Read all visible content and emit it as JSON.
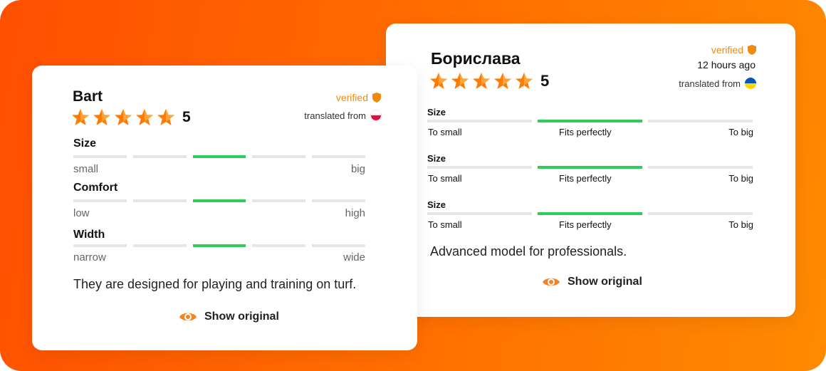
{
  "colors": {
    "accent": "#f0890e",
    "fit_bar": "#2ecc5a",
    "track": "#e6e6e6"
  },
  "left_card": {
    "name": "Bart",
    "verified": "verified",
    "translated": "translated from",
    "flag": "poland-flag-icon",
    "rating": "5",
    "stars_filled": 5,
    "sliders": [
      {
        "label": "Size",
        "min": "small",
        "max": "big",
        "active_segment": 3
      },
      {
        "label": "Comfort",
        "min": "low",
        "max": "high",
        "active_segment": 3
      },
      {
        "label": "Width",
        "min": "narrow",
        "max": "wide",
        "active_segment": 3
      }
    ],
    "review": "They are designed for playing and training on turf.",
    "show_original": "Show original"
  },
  "right_card": {
    "name": "Борислава",
    "verified": "verified",
    "time": "12 hours ago",
    "translated": "translated from",
    "flag": "ukraine-flag-icon",
    "rating": "5",
    "stars_filled": 5,
    "sliders": [
      {
        "label": "Size",
        "min": "To small",
        "mid": "Fits perfectly",
        "max": "To big",
        "active_segment": 2
      },
      {
        "label": "Size",
        "min": "To small",
        "mid": "Fits perfectly",
        "max": "To big",
        "active_segment": 2
      },
      {
        "label": "Size",
        "min": "To small",
        "mid": "Fits perfectly",
        "max": "To big",
        "active_segment": 2
      }
    ],
    "review": "Advanced model for professionals.",
    "show_original": "Show original"
  }
}
